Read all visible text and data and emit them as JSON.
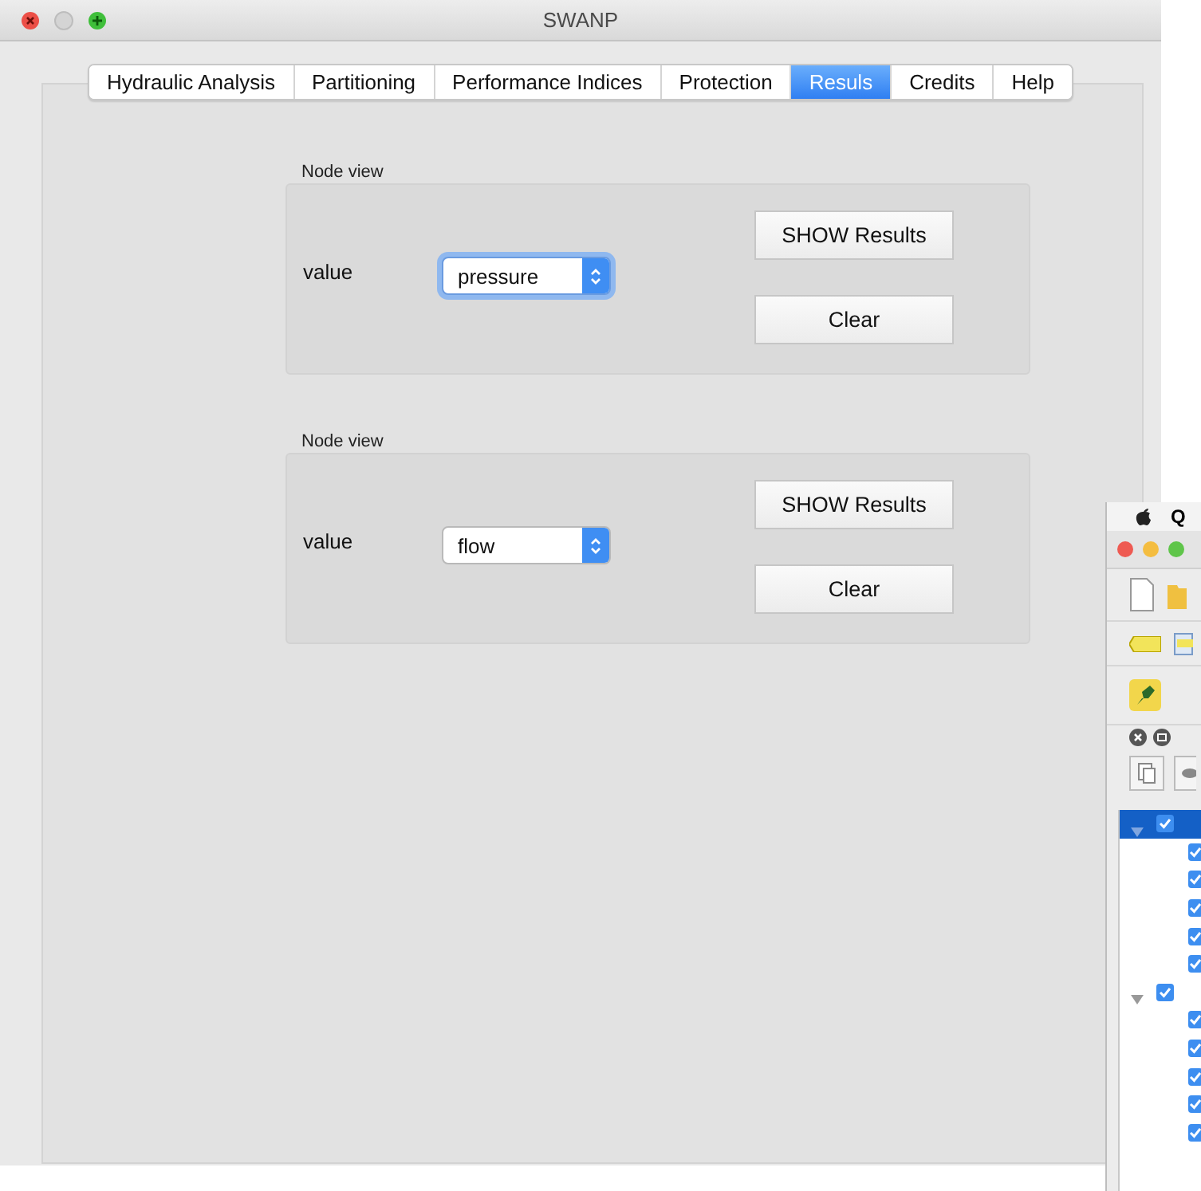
{
  "window": {
    "title": "SWANP"
  },
  "tabs": [
    {
      "label": "Hydraulic Analysis",
      "selected": false
    },
    {
      "label": "Partitioning",
      "selected": false
    },
    {
      "label": "Performance Indices",
      "selected": false
    },
    {
      "label": "Protection",
      "selected": false
    },
    {
      "label": "Resuls",
      "selected": true
    },
    {
      "label": "Credits",
      "selected": false
    },
    {
      "label": "Help",
      "selected": false
    }
  ],
  "groups": [
    {
      "title": "Node view",
      "label": "value",
      "combo": {
        "value": "pressure",
        "focused": true
      },
      "buttons": [
        "SHOW Results",
        "Clear"
      ]
    },
    {
      "title": "Node view",
      "label": "value",
      "combo": {
        "value": "flow",
        "focused": false
      },
      "buttons": [
        "SHOW Results",
        "Clear"
      ]
    }
  ],
  "background_window": {
    "menu_text": "Q",
    "layers": [
      {
        "checked": true,
        "expanded": true,
        "selected": true,
        "children": [
          {
            "checked": true
          },
          {
            "checked": true
          },
          {
            "checked": true
          },
          {
            "checked": true
          },
          {
            "checked": true
          }
        ]
      },
      {
        "checked": true,
        "expanded": true,
        "selected": false,
        "children": [
          {
            "checked": true
          },
          {
            "checked": true
          },
          {
            "checked": true
          },
          {
            "checked": true
          },
          {
            "checked": true
          }
        ]
      }
    ]
  }
}
